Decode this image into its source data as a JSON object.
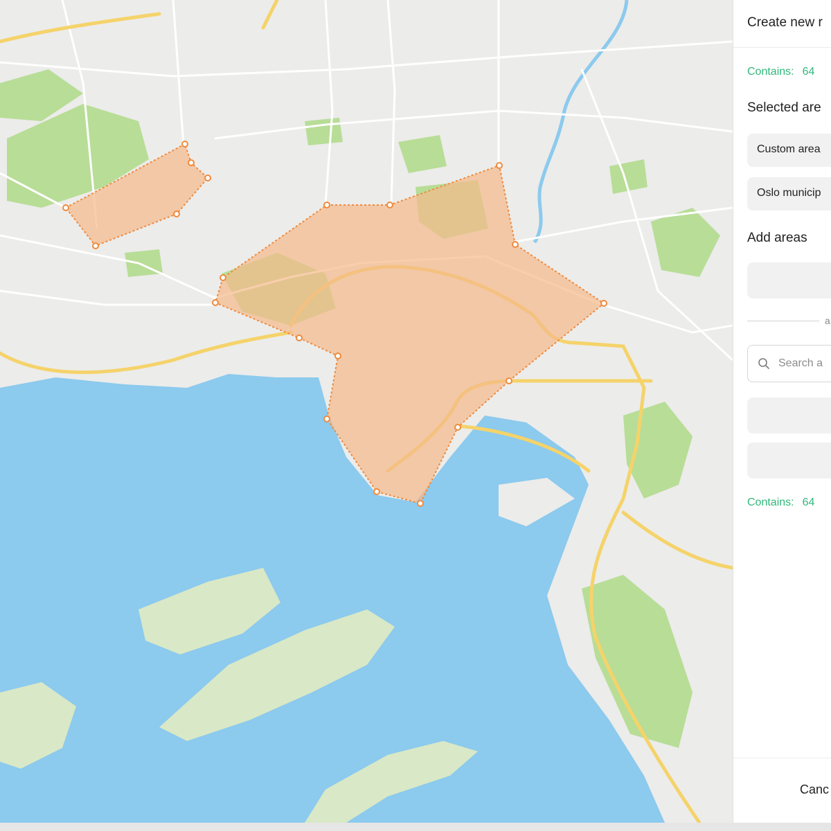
{
  "panel": {
    "title": "Create new r",
    "contains_label": "Contains:",
    "contains_value": "64",
    "selected_heading": "Selected are",
    "selected_areas": [
      "Custom area",
      "Oslo municip"
    ],
    "add_heading": "Add areas",
    "or_text": "a",
    "search_placeholder": "Search a",
    "contains_bottom_label": "Contains:",
    "contains_bottom_value": "64",
    "cancel_label": "Canc"
  },
  "map": {
    "colors": {
      "water": "#8ccaee",
      "land": "#ececea",
      "park": "#b8dd97",
      "road_major": "#f5d36a",
      "road_minor": "#ffffff",
      "area_fill": "#f5b98a",
      "area_stroke": "#f08a3c",
      "vertex_fill": "#ffffff"
    }
  }
}
